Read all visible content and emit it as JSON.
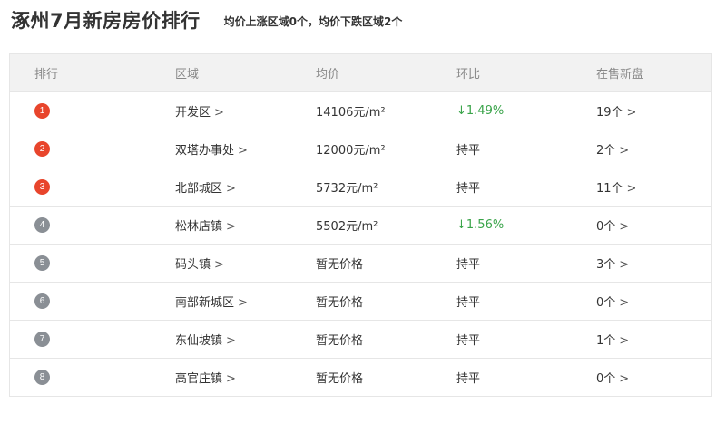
{
  "header": {
    "title": "涿州7月新房房价排行",
    "summary": "均价上涨区域0个，均价下跌区域2个"
  },
  "table": {
    "columns": [
      "排行",
      "区域",
      "均价",
      "环比",
      "在售新盘"
    ],
    "rows": [
      {
        "rank": "1",
        "area": "开发区",
        "price": "14106元/m²",
        "change": "↓1.49%",
        "count": "19个"
      },
      {
        "rank": "2",
        "area": "双塔办事处",
        "price": "12000元/m²",
        "change": "持平",
        "count": "2个"
      },
      {
        "rank": "3",
        "area": "北部城区",
        "price": "5732元/m²",
        "change": "持平",
        "count": "11个"
      },
      {
        "rank": "4",
        "area": "松林店镇",
        "price": "5502元/m²",
        "change": "↓1.56%",
        "count": "0个"
      },
      {
        "rank": "5",
        "area": "码头镇",
        "price": "暂无价格",
        "change": "持平",
        "count": "3个"
      },
      {
        "rank": "6",
        "area": "南部新城区",
        "price": "暂无价格",
        "change": "持平",
        "count": "0个"
      },
      {
        "rank": "7",
        "area": "东仙坡镇",
        "price": "暂无价格",
        "change": "持平",
        "count": "1个"
      },
      {
        "rank": "8",
        "area": "高官庄镇",
        "price": "暂无价格",
        "change": "持平",
        "count": "0个"
      }
    ]
  },
  "icons": {
    "chevron": "chevron-right-icon",
    "chevron_glyph": ">"
  },
  "colors": {
    "rank_top": "#e8452c",
    "rank_other": "#8a8f95",
    "down": "#3aa44a",
    "header_bg": "#f2f2f2",
    "border": "#e6e6e6"
  }
}
